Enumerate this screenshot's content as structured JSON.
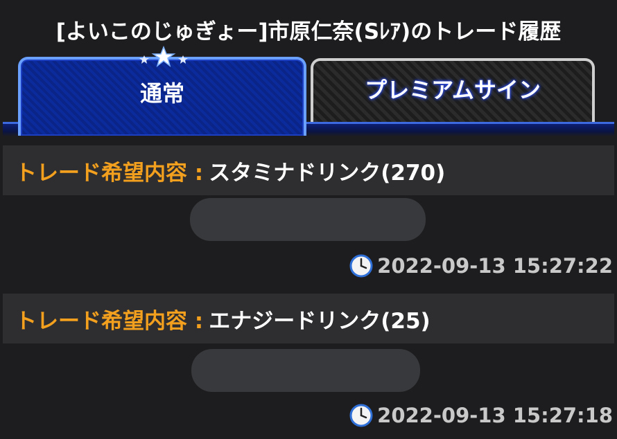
{
  "header": {
    "title": "[よいこのじゅぎょー]市原仁奈(Sﾚｱ)のトレード履歴"
  },
  "tabs": [
    {
      "label": "通常",
      "active": true
    },
    {
      "label": "プレミアムサイン",
      "active": false
    }
  ],
  "entries": [
    {
      "key": "トレード希望内容 :",
      "value": "スタミナドリンク(270)",
      "timestamp": "2022-09-13 15:27:22"
    },
    {
      "key": "トレード希望内容 :",
      "value": "エナジードリンク(25)",
      "timestamp": "2022-09-13 15:27:18"
    }
  ],
  "icons": {
    "clock": "clock-icon",
    "stars": "stars-icon"
  },
  "colors": {
    "background": "#1d1d1f",
    "accent_orange": "#f2a01e",
    "active_tab_blue": "#0b2a9c",
    "timestamp_gray": "#c9c9c9"
  }
}
